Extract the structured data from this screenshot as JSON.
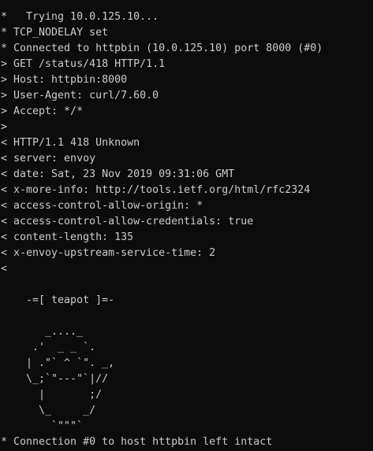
{
  "terminal": {
    "lines": [
      "*   Trying 10.0.125.10...",
      "* TCP_NODELAY set",
      "* Connected to httpbin (10.0.125.10) port 8000 (#0)",
      "> GET /status/418 HTTP/1.1",
      "> Host: httpbin:8000",
      "> User-Agent: curl/7.60.0",
      "> Accept: */*",
      ">",
      "< HTTP/1.1 418 Unknown",
      "< server: envoy",
      "< date: Sat, 23 Nov 2019 09:31:06 GMT",
      "< x-more-info: http://tools.ietf.org/html/rfc2324",
      "< access-control-allow-origin: *",
      "< access-control-allow-credentials: true",
      "< content-length: 135",
      "< x-envoy-upstream-service-time: 2",
      "<",
      "",
      "    -=[ teapot ]=-",
      "",
      "       _...._",
      "     .'  _ _ `.",
      "    | .\"` ^ `\". _,",
      "    \\_;`\"---\"`|//",
      "      |       ;/",
      "      \\_     _/",
      "        `\"\"\"`",
      "* Connection #0 to host httpbin left intact"
    ]
  },
  "colors": {
    "background": "#0c0c0c",
    "text": "#cccccc"
  }
}
